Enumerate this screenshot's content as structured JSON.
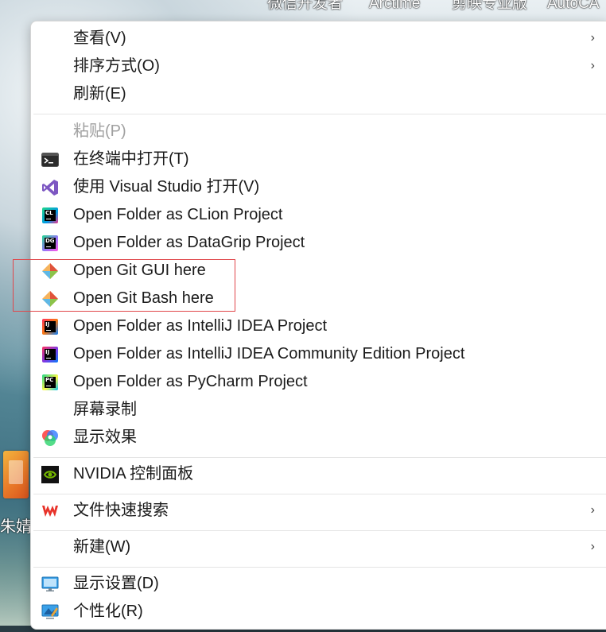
{
  "desktop": {
    "top_labels": [
      "微信开发者",
      "Arctime",
      "剪映专业版",
      "AutoCA"
    ],
    "icon_label": "朱婧"
  },
  "menu": {
    "items": [
      {
        "label": "查看(V)",
        "icon": "",
        "submenu": true,
        "disabled": false
      },
      {
        "label": "排序方式(O)",
        "icon": "",
        "submenu": true,
        "disabled": false
      },
      {
        "label": "刷新(E)",
        "icon": "",
        "submenu": false,
        "disabled": false
      },
      {
        "label": "粘贴(P)",
        "icon": "",
        "submenu": false,
        "disabled": true
      },
      {
        "label": "在终端中打开(T)",
        "icon": "terminal-icon",
        "submenu": false,
        "disabled": false
      },
      {
        "label": "使用 Visual Studio 打开(V)",
        "icon": "visual-studio-icon",
        "submenu": false,
        "disabled": false
      },
      {
        "label": "Open Folder as CLion Project",
        "icon": "clion-icon",
        "badge": "CL",
        "submenu": false,
        "disabled": false
      },
      {
        "label": "Open Folder as DataGrip Project",
        "icon": "datagrip-icon",
        "badge": "DG",
        "submenu": false,
        "disabled": false
      },
      {
        "label": "Open Git GUI here",
        "icon": "git-icon",
        "submenu": false,
        "disabled": false
      },
      {
        "label": "Open Git Bash here",
        "icon": "git-icon",
        "submenu": false,
        "disabled": false
      },
      {
        "label": "Open Folder as IntelliJ IDEA Project",
        "icon": "intellij-idea-icon",
        "badge": "IJ",
        "submenu": false,
        "disabled": false
      },
      {
        "label": "Open Folder as IntelliJ IDEA Community Edition Project",
        "icon": "intellij-idea-community-icon",
        "badge": "IJ",
        "submenu": false,
        "disabled": false
      },
      {
        "label": "Open Folder as PyCharm Project",
        "icon": "pycharm-icon",
        "badge": "PC",
        "submenu": false,
        "disabled": false
      },
      {
        "label": "屏幕录制",
        "icon": "",
        "submenu": false,
        "disabled": false
      },
      {
        "label": "显示效果",
        "icon": "display-effects-icon",
        "submenu": false,
        "disabled": false
      },
      {
        "label": "NVIDIA 控制面板",
        "icon": "nvidia-icon",
        "submenu": false,
        "disabled": false
      },
      {
        "label": "文件快速搜索",
        "icon": "wps-icon",
        "submenu": true,
        "disabled": false
      },
      {
        "label": "新建(W)",
        "icon": "",
        "submenu": true,
        "disabled": false
      },
      {
        "label": "显示设置(D)",
        "icon": "display-settings-icon",
        "submenu": false,
        "disabled": false
      },
      {
        "label": "个性化(R)",
        "icon": "personalize-icon",
        "submenu": false,
        "disabled": false
      }
    ],
    "submenu_glyph": "›",
    "colors": {
      "highlight_border": "#e0464a",
      "clion": "#21d789",
      "datagrip": "#22d88f",
      "intellij": "#fe315d",
      "pycharm": "#21d789",
      "visual_studio": "#7d57c2",
      "git": "#f05133",
      "nvidia": "#76b900",
      "wps": "#e8332a"
    }
  }
}
